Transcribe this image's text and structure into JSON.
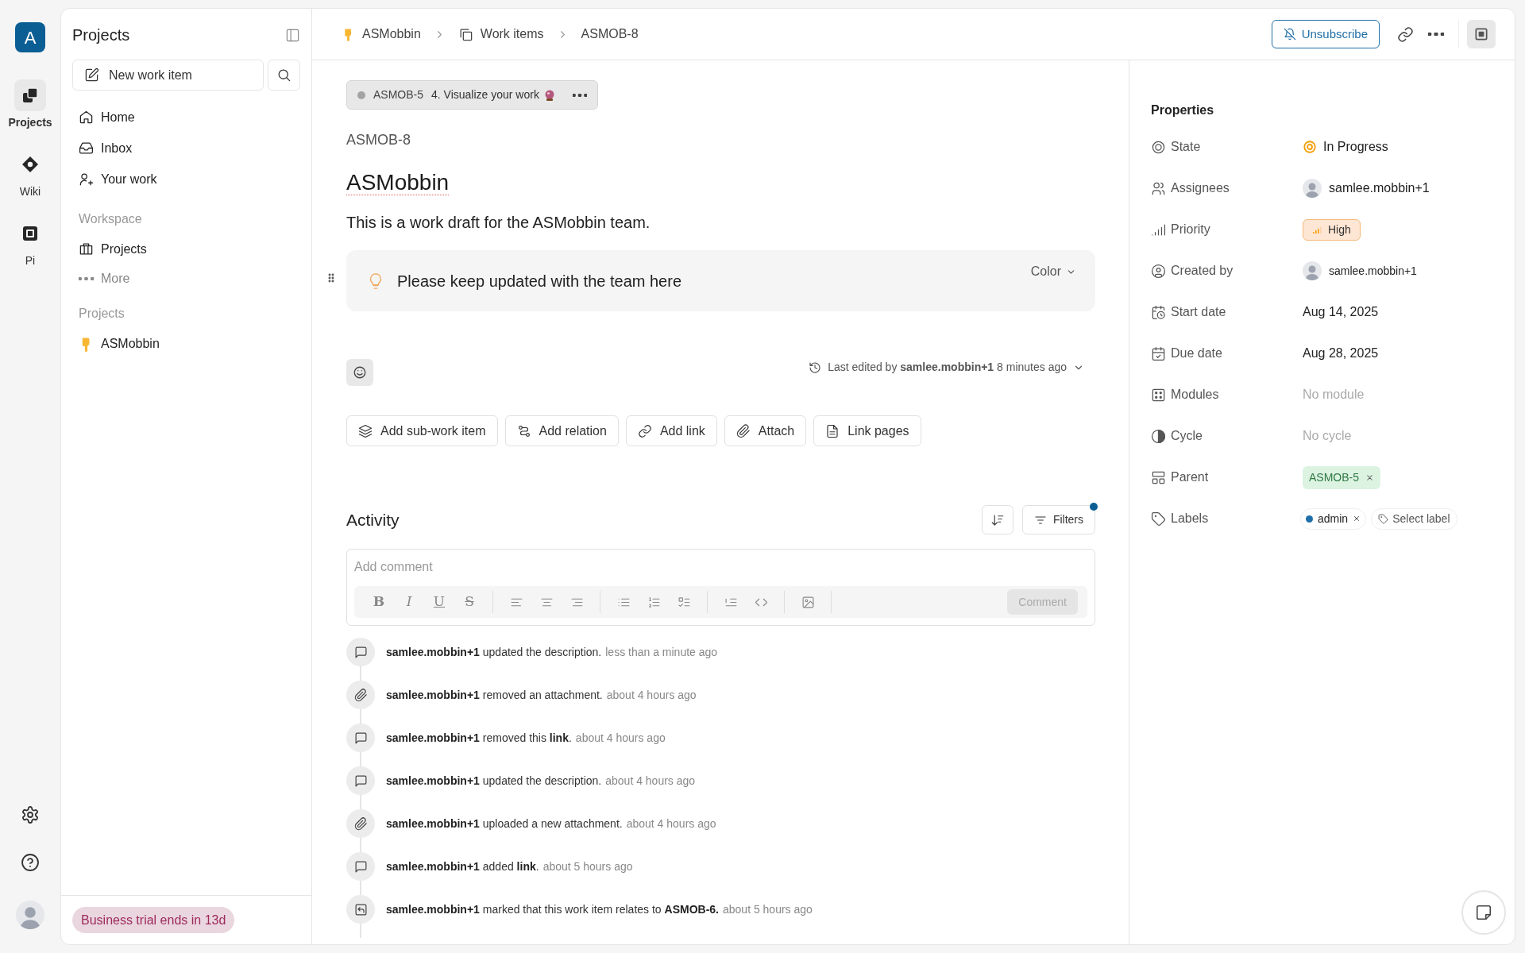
{
  "rail": {
    "logo": "A",
    "items": [
      {
        "label": "Projects",
        "selected": true
      },
      {
        "label": "Wiki",
        "selected": false
      },
      {
        "label": "Pi",
        "selected": false
      }
    ]
  },
  "sidebar": {
    "title": "Projects",
    "new_item": "New work item",
    "nav": [
      {
        "label": "Home"
      },
      {
        "label": "Inbox"
      },
      {
        "label": "Your work"
      }
    ],
    "workspace": {
      "heading": "Workspace",
      "items": [
        {
          "label": "Projects"
        },
        {
          "label": "More"
        }
      ]
    },
    "projects": {
      "heading": "Projects",
      "items": [
        {
          "label": "ASMobbin"
        }
      ]
    },
    "trial_badge": "Business trial ends in 13d"
  },
  "header": {
    "breadcrumbs": [
      "ASMobbin",
      "Work items",
      "ASMOB-8"
    ],
    "unsubscribe": "Unsubscribe"
  },
  "issue": {
    "parent": {
      "id": "ASMOB-5",
      "title": "4. Visualize your work"
    },
    "id": "ASMOB-8",
    "title": "ASMobbin",
    "description": "This is a work draft for the ASMobbin team.",
    "callout": {
      "text": "Please keep updated with the team here",
      "color_menu": "Color"
    },
    "last_edited": "Last edited by **samlee.mobbin+1** 8 minutes ago",
    "actions": [
      "Add sub-work item",
      "Add relation",
      "Add link",
      "Attach",
      "Link pages"
    ]
  },
  "activity": {
    "title": "Activity",
    "filters": {
      "label": "Filters",
      "active": true
    },
    "comment": {
      "placeholder": "Add comment",
      "format_tools": [
        "B",
        "I",
        "U",
        "S"
      ],
      "submit": "Comment",
      "disabled": true
    },
    "items": [
      {
        "kind": "comment",
        "text": "**samlee.mobbin+1** updated the description.",
        "time": "less than a minute ago"
      },
      {
        "kind": "attachment",
        "text": "**samlee.mobbin+1** removed an attachment.",
        "time": "about 4 hours ago"
      },
      {
        "kind": "comment",
        "text": "**samlee.mobbin+1** removed this **link**.",
        "time": "about 4 hours ago"
      },
      {
        "kind": "comment",
        "text": "**samlee.mobbin+1** updated the description.",
        "time": "about 4 hours ago"
      },
      {
        "kind": "attachment",
        "text": "**samlee.mobbin+1** uploaded a new attachment.",
        "time": "about 4 hours ago"
      },
      {
        "kind": "comment",
        "text": "**samlee.mobbin+1** added **link**.",
        "time": "about 5 hours ago"
      },
      {
        "kind": "relation",
        "text": "**samlee.mobbin+1** marked that this work item relates to **ASMOB-6.**",
        "time": "about 5 hours ago"
      }
    ]
  },
  "properties": {
    "title": "Properties",
    "rows": [
      {
        "label": "State",
        "kind": "state",
        "value": "In Progress"
      },
      {
        "label": "Assignees",
        "kind": "user",
        "value": "samlee.mobbin+1"
      },
      {
        "label": "Priority",
        "kind": "priority",
        "value": "High"
      },
      {
        "label": "Created by",
        "kind": "user",
        "value": "samlee.mobbin+1"
      },
      {
        "label": "Start date",
        "kind": "text",
        "value": "Aug 14, 2025"
      },
      {
        "label": "Due date",
        "kind": "text",
        "value": "Aug 28, 2025"
      },
      {
        "label": "Modules",
        "kind": "empty",
        "value": "No module"
      },
      {
        "label": "Cycle",
        "kind": "empty",
        "value": "No cycle"
      },
      {
        "label": "Parent",
        "kind": "parent",
        "value": "ASMOB-5"
      },
      {
        "label": "Labels",
        "kind": "labels",
        "labels": [
          {
            "name": "admin",
            "color": "#1f6fa8"
          }
        ],
        "add": "Select label"
      }
    ]
  }
}
